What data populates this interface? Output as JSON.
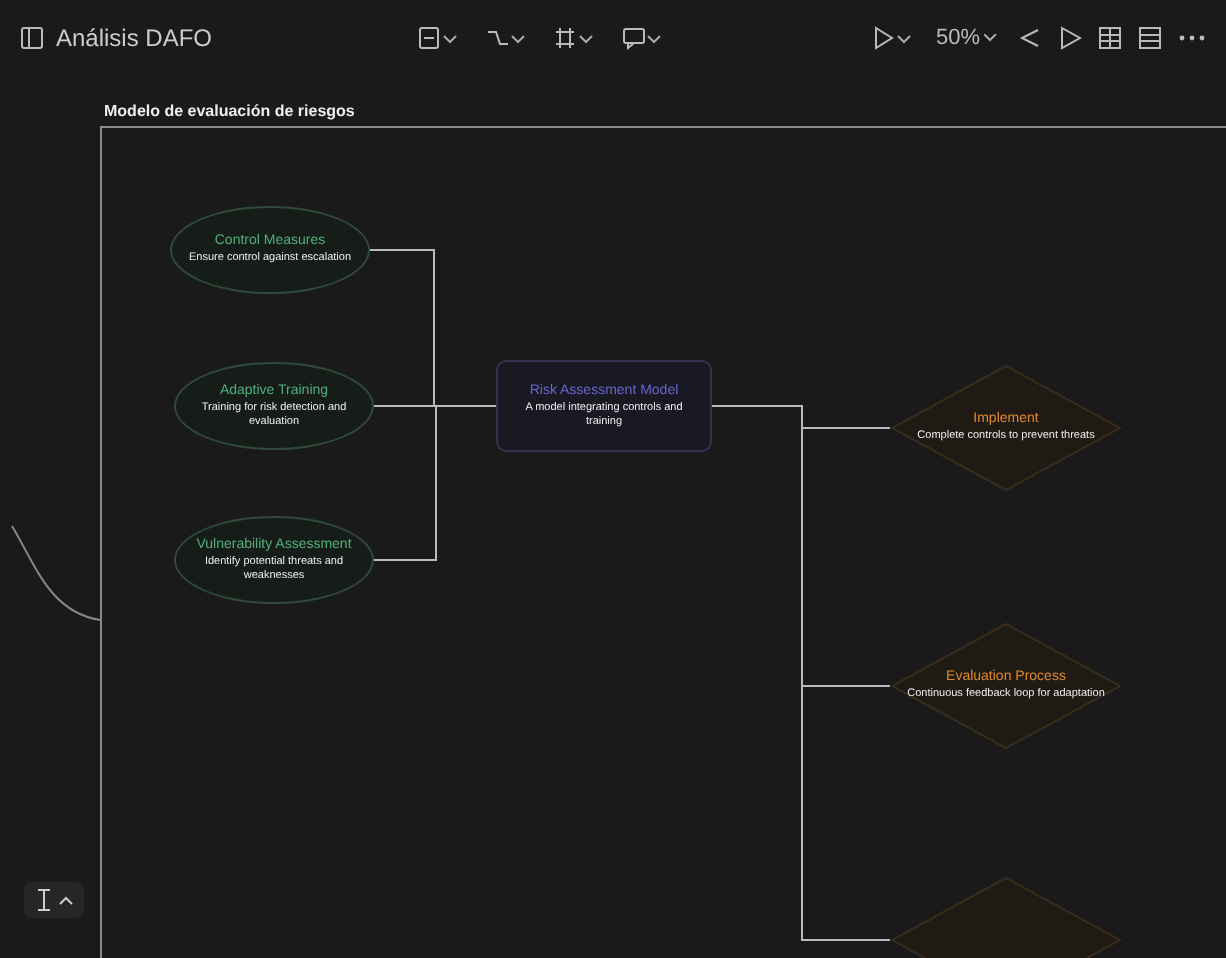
{
  "window": {
    "title": "Análisis DAFO"
  },
  "toolbar": {
    "zoom": "50%"
  },
  "frame": {
    "label": "Modelo de evaluación de riesgos"
  },
  "nodes": [
    {
      "kind": "ellipse",
      "title": "Control Measures",
      "subtitle": "Ensure control against escalation"
    },
    {
      "kind": "ellipse",
      "title": "Adaptive Training",
      "subtitle": "Training for risk detection and evaluation"
    },
    {
      "kind": "ellipse",
      "title": "Vulnerability Assessment",
      "subtitle": "Identify potential threats and weaknesses"
    },
    {
      "kind": "rect",
      "title": "Risk Assessment Model",
      "subtitle": "A model integrating controls and training"
    },
    {
      "kind": "diamond",
      "title": "Implement",
      "subtitle": "Complete controls to prevent threats"
    },
    {
      "kind": "diamond",
      "title": "Evaluation Process",
      "subtitle": "Continuous feedback loop for adaptation"
    },
    {
      "kind": "diamond"
    }
  ]
}
